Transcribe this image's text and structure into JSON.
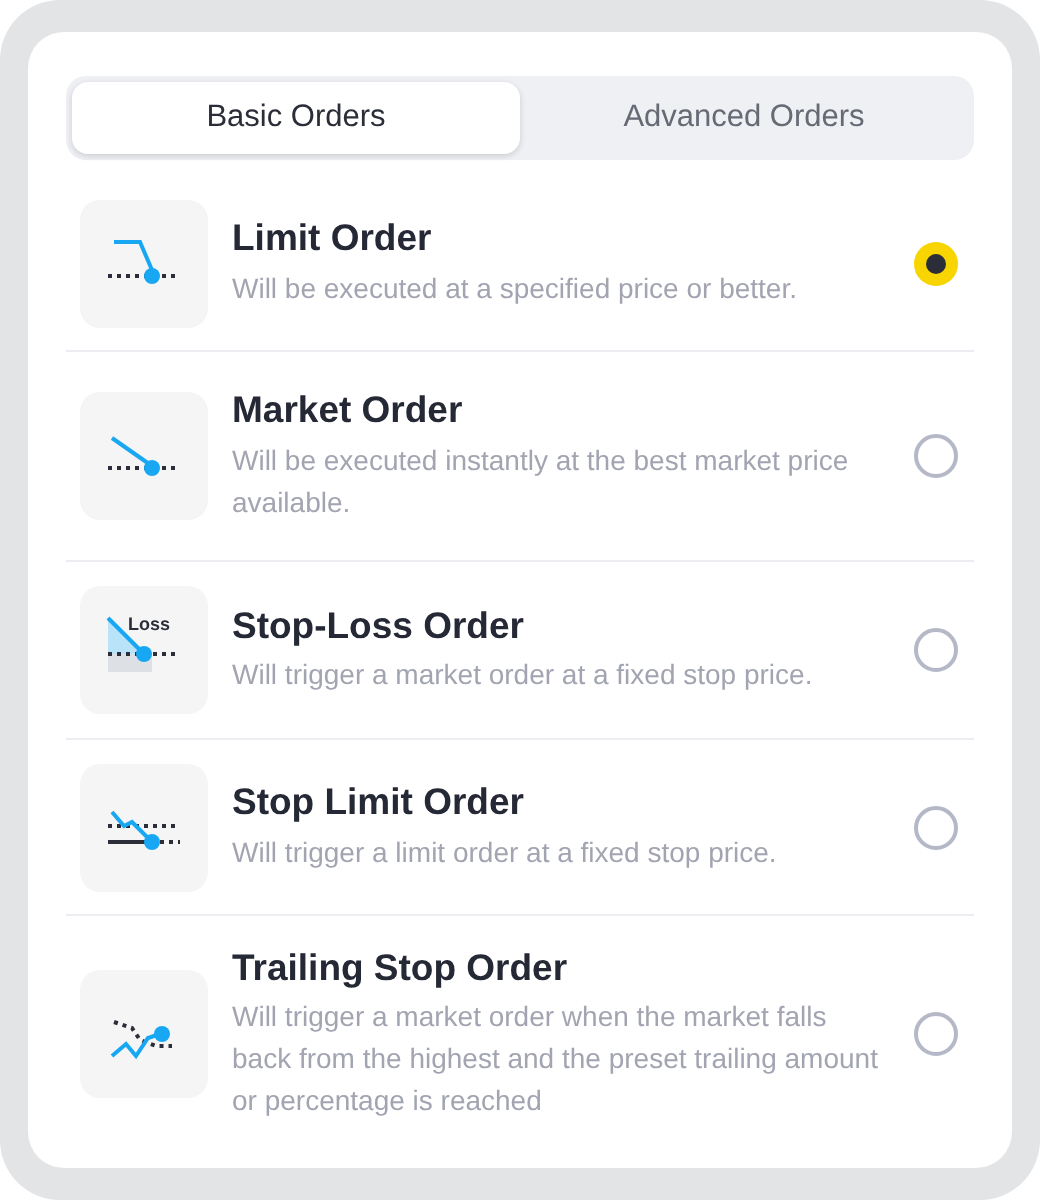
{
  "tabs": [
    {
      "label": "Basic Orders",
      "selected": true
    },
    {
      "label": "Advanced Orders",
      "selected": false
    }
  ],
  "orders": [
    {
      "kind": "limit",
      "title": "Limit Order",
      "description": "Will be executed at a specified price or better.",
      "selected": true
    },
    {
      "kind": "market",
      "title": "Market Order",
      "description": "Will be executed instantly at the best market price available.",
      "selected": false
    },
    {
      "kind": "stop-loss",
      "icon_text": "Loss",
      "title": "Stop-Loss Order",
      "description": "Will trigger a market order at a fixed stop price.",
      "selected": false
    },
    {
      "kind": "stop-limit",
      "title": "Stop Limit Order",
      "description": "Will trigger a limit order at a fixed stop price.",
      "selected": false
    },
    {
      "kind": "trailing",
      "title": "Trailing Stop Order",
      "description": "Will trigger a market order when the market falls back from the highest and the preset trailing amount or percentage is reached",
      "selected": false
    }
  ]
}
